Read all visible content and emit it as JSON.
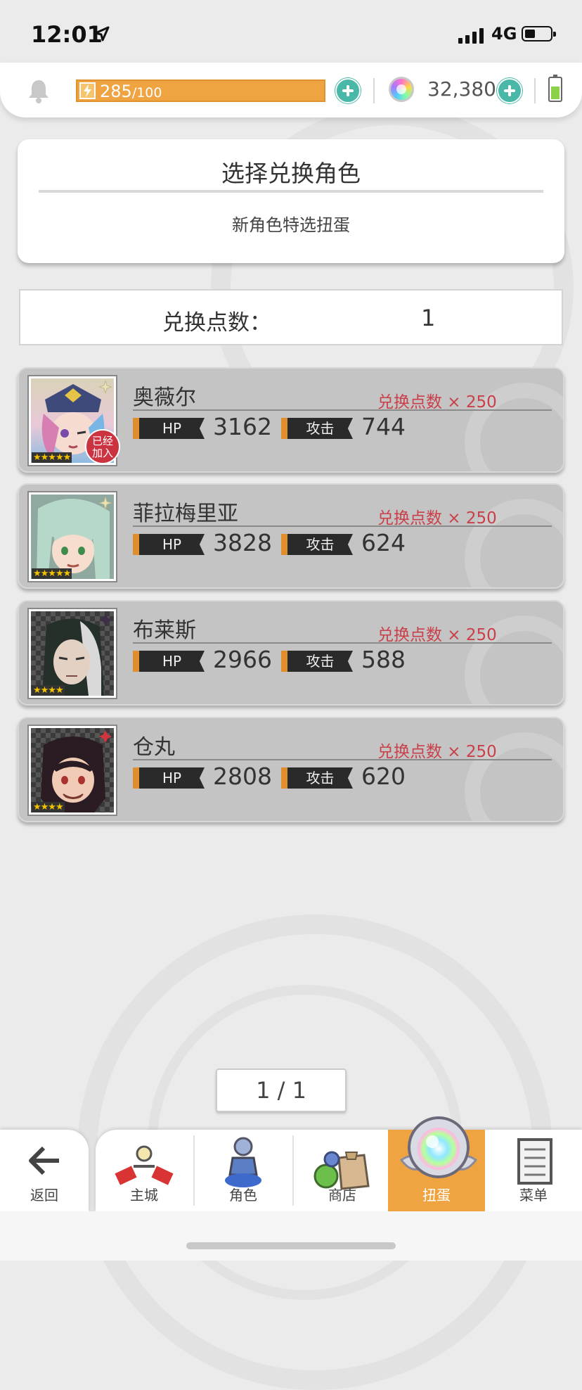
{
  "status_bar": {
    "time": "12:01",
    "network": "4G"
  },
  "resources": {
    "stamina_current": "285",
    "stamina_max": "/100",
    "gems": "32,380"
  },
  "header": {
    "title": "选择兑换角色",
    "subtitle": "新角色特选扭蛋"
  },
  "points": {
    "label": "兑换点数：",
    "value": "1"
  },
  "stat_labels": {
    "hp": "HP",
    "attack": "攻击"
  },
  "characters": [
    {
      "name": "奥薇尔",
      "cost": "兑换点数 × 250",
      "hp": "3162",
      "attack": "744",
      "stars": "★★★★★",
      "badge": "已经加入"
    },
    {
      "name": "菲拉梅里亚",
      "cost": "兑换点数 × 250",
      "hp": "3828",
      "attack": "624",
      "stars": "★★★★★"
    },
    {
      "name": "布莱斯",
      "cost": "兑换点数 × 250",
      "hp": "2966",
      "attack": "588",
      "stars": "★★★★"
    },
    {
      "name": "仓丸",
      "cost": "兑换点数 × 250",
      "hp": "2808",
      "attack": "620",
      "stars": "★★★★"
    }
  ],
  "pagination": "1 / 1",
  "nav": {
    "back": "返回",
    "items": [
      {
        "label": "主城",
        "icon": "castle-icon"
      },
      {
        "label": "角色",
        "icon": "character-icon"
      },
      {
        "label": "商店",
        "icon": "shop-icon"
      },
      {
        "label": "扭蛋",
        "icon": "gacha-icon",
        "active": true
      },
      {
        "label": "菜单",
        "icon": "menu-icon"
      }
    ]
  },
  "colors": {
    "accent": "#f0a441",
    "cost_red": "#c9404a",
    "plus_teal": "#4ab8a8"
  }
}
